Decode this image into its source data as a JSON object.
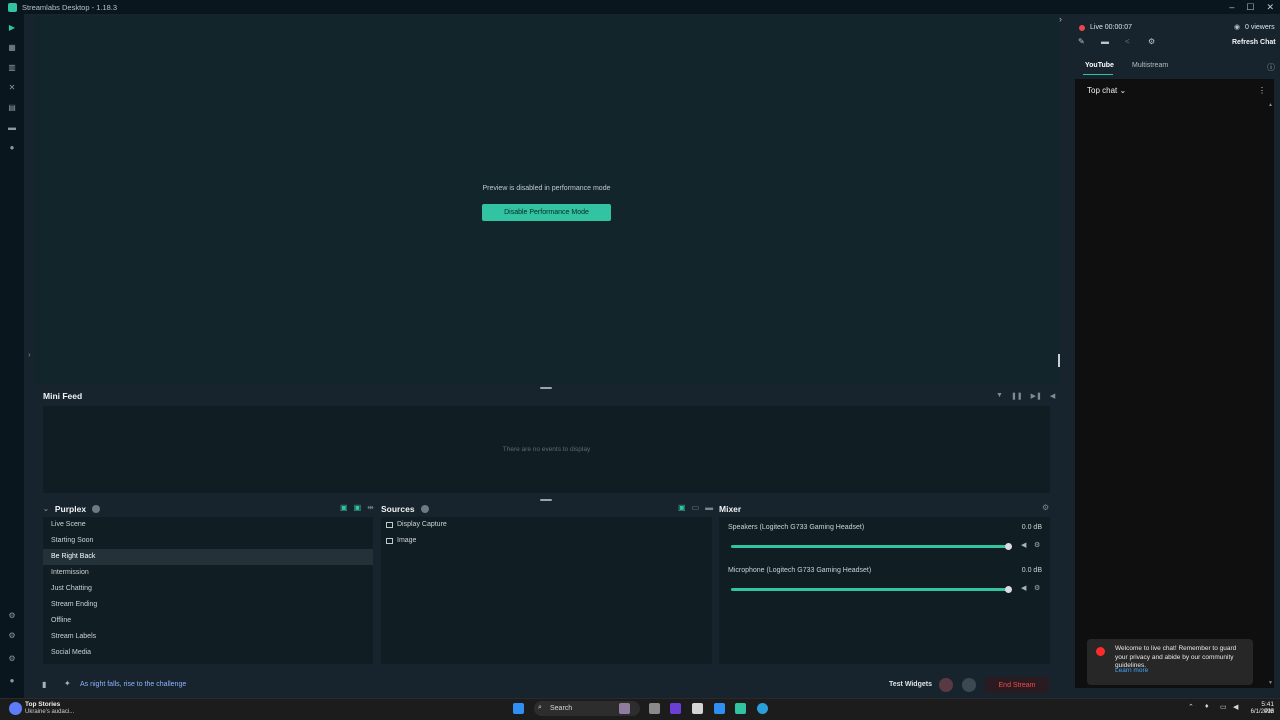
{
  "window": {
    "title": "Streamlabs Desktop - 1.18.3"
  },
  "preview": {
    "message": "Preview is disabled in performance mode",
    "button_label": "Disable Performance Mode"
  },
  "minifeed": {
    "title": "Mini Feed",
    "empty_text": "There are no events to display"
  },
  "scenes": {
    "collection_name": "Purplex",
    "items": [
      "Live Scene",
      "Starting Soon",
      "Be Right Back",
      "Intermission",
      "Just Chatting",
      "Stream Ending",
      "Offline",
      "Stream Labels",
      "Social Media"
    ],
    "active_index": 2
  },
  "sources": {
    "title": "Sources",
    "items": [
      "Display Capture",
      "Image"
    ]
  },
  "mixer": {
    "title": "Mixer",
    "tracks": [
      {
        "name": "Speakers (Logitech G733 Gaming Headset)",
        "db": "0.0 dB",
        "level": 1.0
      },
      {
        "name": "Microphone (Logitech G733 Gaming Headset)",
        "db": "0.0 dB",
        "level": 1.0
      }
    ]
  },
  "footer": {
    "motd": "As night falls, rise to the challenge",
    "test_widgets": "Test Widgets",
    "end_stream": "End Stream"
  },
  "chat": {
    "live_status": "Live 00:00:07",
    "viewers": "0 viewers",
    "refresh": "Refresh Chat",
    "tabs": [
      "YouTube",
      "Multistream"
    ],
    "active_tab": 0,
    "top_chat": "Top chat",
    "welcome_text": "Welcome to live chat! Remember to guard your privacy and abide by our community guidelines.",
    "learn_more": "Learn more"
  },
  "taskbar": {
    "news_title": "Top Stories",
    "news_sub": "Ukraine's audaci...",
    "search": "Search",
    "time": "5:41 PM",
    "date": "6/1/2025"
  },
  "colors": {
    "accent": "#31c3a2",
    "end_stream": "#f04a4a",
    "live": "#e8474c"
  }
}
